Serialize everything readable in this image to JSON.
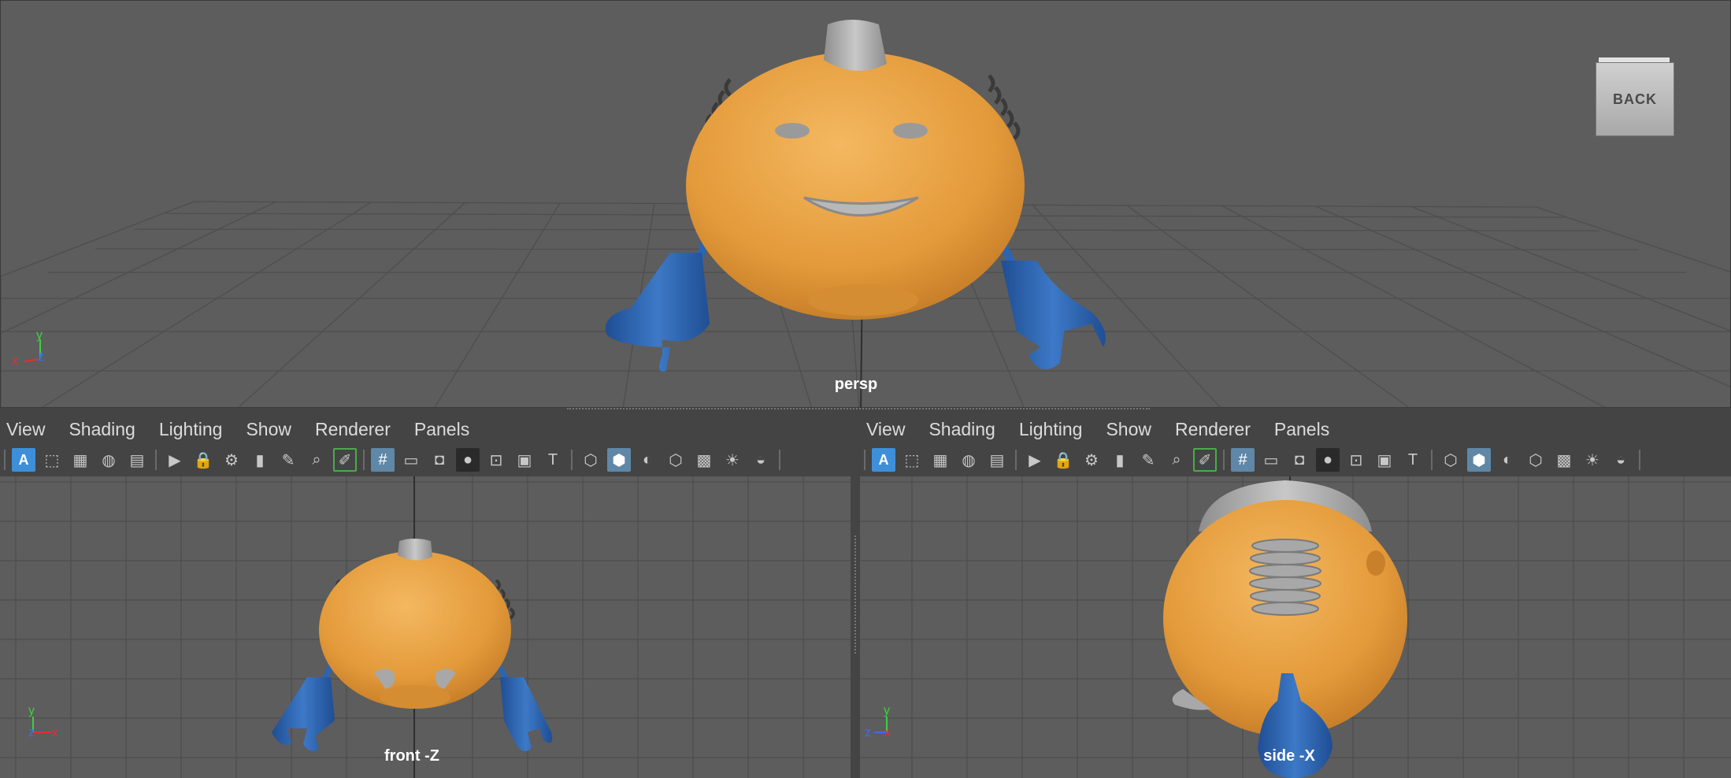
{
  "viewports": {
    "persp": {
      "label": "persp",
      "view_cube_label": "BACK"
    },
    "front": {
      "label": "front -Z"
    },
    "side": {
      "label": "side -X"
    }
  },
  "panel_menus": {
    "front": [
      "View",
      "Shading",
      "Lighting",
      "Show",
      "Renderer",
      "Panels"
    ],
    "side": [
      "View",
      "Shading",
      "Lighting",
      "Show",
      "Renderer",
      "Panels"
    ]
  },
  "toolbar_icons": [
    "select-camera-icon",
    "camera-attributes-icon",
    "image-plane-icon",
    "grease-pencil-icon",
    "bookmarks-icon",
    "camera-icon",
    "lock-camera-icon",
    "camera-settings-icon",
    "bookmark-icon",
    "pencil-icon",
    "zoom-icon",
    "2d-pan-icon",
    "grid-icon",
    "film-gate-icon",
    "resolution-gate-icon",
    "gate-mask-icon",
    "field-chart-icon",
    "safe-action-icon",
    "safe-title-icon",
    "wireframe-icon",
    "smooth-shade-icon",
    "default-material-icon",
    "wireframe-on-shaded-icon",
    "textured-icon",
    "lights-icon",
    "shadows-icon"
  ],
  "axis_labels": {
    "persp": {
      "x": "x",
      "y": "y",
      "z": "z"
    },
    "front": {
      "x": "x",
      "y": "y",
      "z": "z"
    },
    "side": {
      "x": "x",
      "y": "y",
      "z": "z"
    }
  },
  "colors": {
    "viewport_bg": "#5d5d5d",
    "grid": "#4a4a4a",
    "body_orange": "#e9a040",
    "arms_blue": "#2d64b0",
    "metal_gray": "#a8a8a8",
    "active_blue": "#5f87a8"
  }
}
